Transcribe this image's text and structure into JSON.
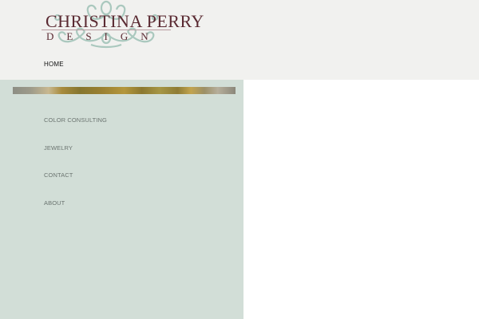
{
  "logo": {
    "line1": "CHRISTINA PERRY",
    "line2": "DESIGN"
  },
  "nav": {
    "home": "HOME"
  },
  "sidebar": {
    "items": [
      {
        "label": "COLOR CONSULTING"
      },
      {
        "label": "JEWELRY"
      },
      {
        "label": "CONTACT"
      },
      {
        "label": "ABOUT"
      }
    ]
  },
  "colors": {
    "header_bg": "#f1f1ef",
    "sidebar_bg": "#d2ded7",
    "logo_text": "#5a2a32",
    "logo_ornament": "#9ec2b6"
  }
}
